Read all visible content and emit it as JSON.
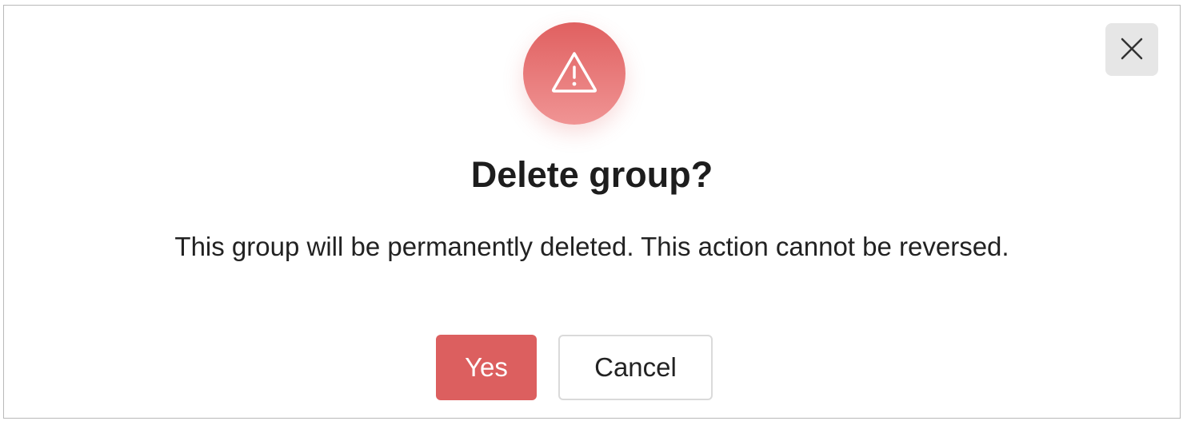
{
  "dialog": {
    "title": "Delete group?",
    "message": "This group will be permanently deleted. This action cannot be reversed.",
    "yes_label": "Yes",
    "cancel_label": "Cancel",
    "close_icon": "close-icon",
    "warning_icon": "warning-triangle-icon"
  },
  "colors": {
    "accent": "#dc5f5f",
    "badge_top": "#e06060",
    "badge_bottom": "#f09494",
    "close_bg": "#e6e6e6"
  }
}
